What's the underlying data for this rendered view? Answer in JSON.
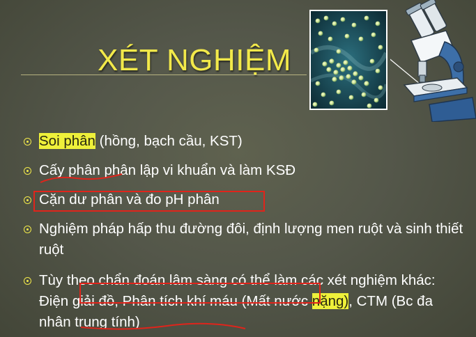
{
  "slide": {
    "title": "XÉT NGHIỆM",
    "bullets": [
      {
        "parts": [
          {
            "text": "Soi phân",
            "highlight": true
          },
          {
            "text": " (hồng, bạch cầu, KST)",
            "highlight": false
          }
        ]
      },
      {
        "parts": [
          {
            "text": "Cấy phân phân lập vi khuẩn và làm KSĐ",
            "highlight": false
          }
        ]
      },
      {
        "parts": [
          {
            "text": "Cặn dư phân và đo pH phân",
            "highlight": false
          }
        ]
      },
      {
        "parts": [
          {
            "text": "Nghiệm pháp hấp thu đường đôi, định lượng men ruột và sinh thiết ruột",
            "highlight": false
          }
        ]
      },
      {
        "parts": [
          {
            "text": "Tùy theo chẩn đoán lâm sàng có thể làm các xét nghiệm khác: Điện giải đồ, Phân tích khí máu (Mất nước ",
            "highlight": false
          },
          {
            "text": "nặng)",
            "highlight": true
          },
          {
            "text": ", CTM (Bc đa nhân trung tính)",
            "highlight": false
          }
        ]
      }
    ]
  },
  "colors": {
    "background": "#54574a",
    "title": "#f2e94a",
    "highlight": "#eef03a",
    "annotation_red": "#e0241b"
  },
  "icons": {
    "bullet": "circle-dot-bullet-icon",
    "virus_micrograph": "virus-micrograph-image",
    "microscope": "microscope-icon"
  }
}
